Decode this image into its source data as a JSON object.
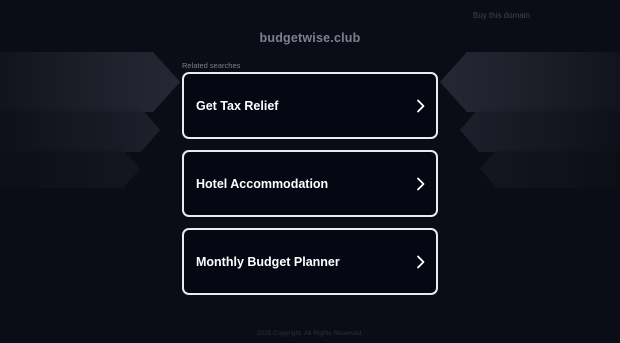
{
  "header": {
    "buy_link": "Buy this domain",
    "domain": "budgetwise.club"
  },
  "related": {
    "label": "Related searches",
    "items": [
      {
        "label": "Get Tax Relief"
      },
      {
        "label": "Hotel Accommodation"
      },
      {
        "label": "Monthly Budget Planner"
      }
    ]
  },
  "footer": {
    "text": "2025 Copyright. All Rights Reserved."
  },
  "colors": {
    "background": "#0b0d16",
    "card_border": "#e9ebf2",
    "card_bg": "#050712",
    "text_primary": "#ffffff"
  },
  "icons": {
    "result_arrow": "chevron-right-icon"
  }
}
